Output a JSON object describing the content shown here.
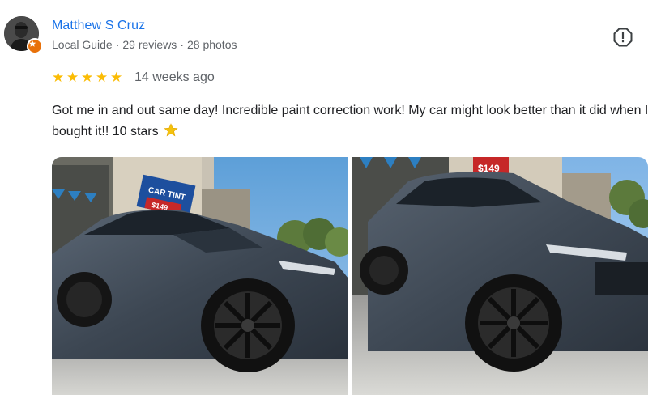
{
  "reviewer": {
    "name": "Matthew S Cruz",
    "meta": [
      "Local Guide",
      "·",
      "29 reviews",
      "·",
      "28 photos"
    ]
  },
  "rating": {
    "stars": 5,
    "max": 5,
    "time_ago": "14 weeks ago"
  },
  "review": {
    "text": "Got me in and out same day! Incredible paint correction work! My car might look better than it did when I bought it!! 10 stars"
  },
  "photos": {
    "photo_1": {
      "sign_text": "CAR TINT",
      "price_text": "$149"
    },
    "photo_2": {
      "price_text": "$149"
    }
  },
  "colors": {
    "name": "#1a73e8",
    "meta": "#5f6368",
    "stars": "#fbbc04",
    "text": "#202124",
    "local_guide_badge": "#e8710a"
  },
  "icons": {
    "report": "report-icon",
    "local_guide": "local-guide-badge-icon",
    "star_emoji": "star-emoji-icon"
  }
}
